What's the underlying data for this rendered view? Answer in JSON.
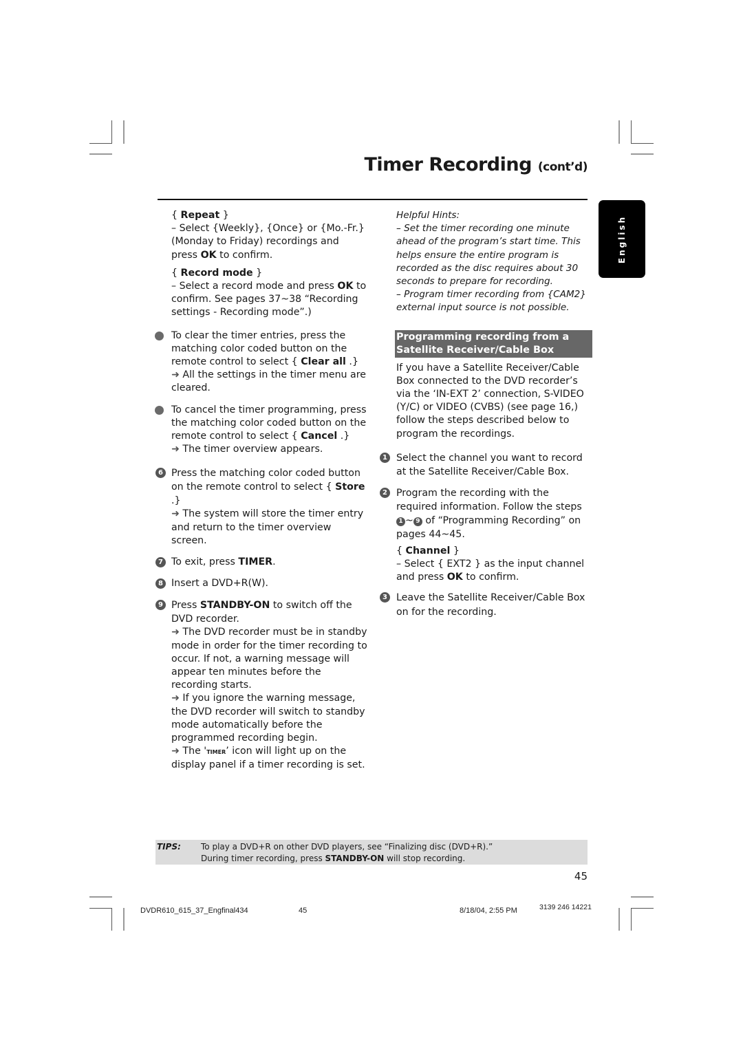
{
  "header": {
    "title": "Timer Recording",
    "title_suffix": "(cont’d)",
    "language_tab": "English"
  },
  "left_column": {
    "repeat": {
      "heading": "Repeat",
      "text_before": "–  Select {Weekly}, {Once} or {Mo.-Fr.} (Monday to Friday) recordings and press ",
      "bold": "OK",
      "text_after": " to confirm."
    },
    "record_mode": {
      "heading": "Record mode",
      "text_before": "–  Select a record mode and press ",
      "bold": "OK",
      "text_after": " to confirm.  See pages 37~38 “Recording settings - Recording mode”.)"
    },
    "bullets": [
      {
        "text_before": "To clear the timer entries, press the matching color coded button on the remote control to select { ",
        "bold": "Clear all",
        "text_after": " .}",
        "result": "All the settings in the timer menu are cleared."
      },
      {
        "text_before": "To cancel the timer programming,  press the matching color coded button on the remote control to select { ",
        "bold": "Cancel",
        "text_after": " .}",
        "result": "The timer overview appears."
      }
    ],
    "steps": [
      {
        "number": "6",
        "text_before": "Press the matching color coded button on the remote control to select { ",
        "bold": "Store",
        "text_after": " .}",
        "result": "The system will store the timer entry and return to the timer overview screen."
      },
      {
        "number": "7",
        "text_before": "To exit, press ",
        "bold": "TIMER",
        "text_after": "."
      },
      {
        "number": "8",
        "text_before": "Insert a DVD+R(W).",
        "bold": "",
        "text_after": ""
      },
      {
        "number": "9",
        "text_before": "Press ",
        "bold": "STANDBY-ON",
        "text_after": " to switch off the DVD recorder.",
        "results": [
          "The DVD recorder must be in standby mode in order for the timer recording to occur.  If not, a warning message will appear ten minutes before the recording starts.",
          " If you ignore the warning message, the DVD recorder will switch to standby mode automatically before the programmed recording begin."
        ],
        "timer_note": {
          "before": "The '",
          "smallcaps": "timer",
          "after": "’ icon will light up on the display panel if a timer recording is set."
        }
      }
    ]
  },
  "right_column": {
    "hints": {
      "title": "Helpful Hints:",
      "items": [
        "–  Set the timer recording one minute ahead of the program’s start time. This helps ensure the entire program is recorded as the disc requires about 30 seconds to prepare for recording.",
        "–  Program timer recording from {CAM2} external input source is not possible."
      ]
    },
    "section_heading": "Programming recording from a Satellite Receiver/Cable Box",
    "intro": "If you have a Satellite Receiver/Cable Box connected to the DVD recorder’s via the ‘IN-EXT 2’ connection, S-VIDEO (Y/C) or VIDEO (CVBS) (see page 16,) follow the steps described below to program the recordings.",
    "steps": [
      {
        "number": "1",
        "text": "Select the channel you want to record at the Satellite Receiver/Cable Box."
      },
      {
        "number": "2",
        "text_before": "Program the recording with the required information.  Follow the steps ",
        "ref_start": "1",
        "ref_sep": "~",
        "ref_end": "9",
        "text_after": " of “Programming Recording” on pages 44~45.",
        "channel": {
          "heading": "Channel",
          "text_before": "–  Select { EXT2 } as the input channel and press ",
          "bold": "OK",
          "text_after": " to confirm."
        }
      },
      {
        "number": "3",
        "text": "Leave the Satellite Receiver/Cable Box on for the recording."
      }
    ]
  },
  "tips": {
    "label": "TIPS:",
    "line1": "To play a DVD+R on other DVD players, see “Finalizing disc (DVD+R).”",
    "line2_before": "During timer recording, press ",
    "line2_bold": "STANDBY-ON",
    "line2_after": " will stop recording."
  },
  "page_number": "45",
  "footer": {
    "file": "DVDR610_615_37_Engfinal434",
    "page": "45",
    "datetime": "8/18/04, 2:55 PM",
    "code": "3139 246 14221"
  }
}
